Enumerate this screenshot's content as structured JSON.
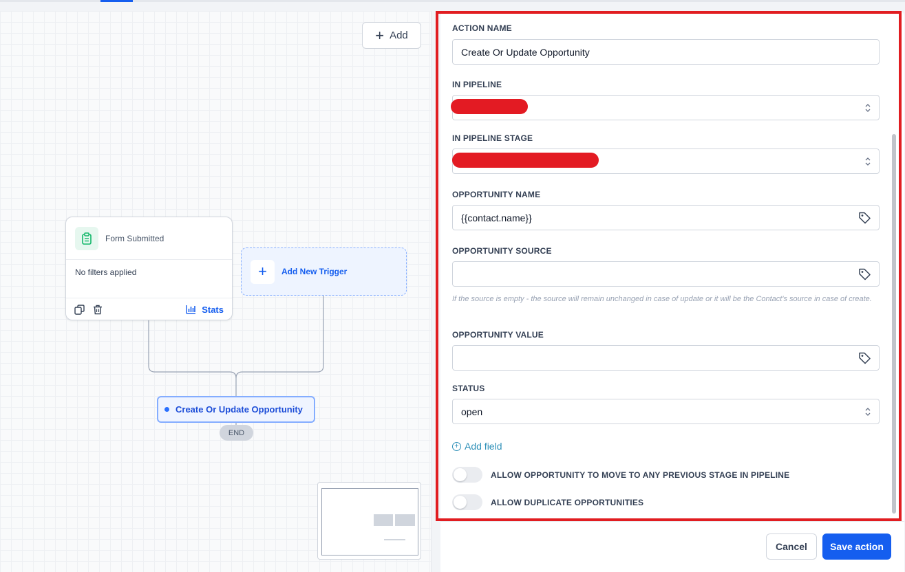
{
  "canvas": {
    "add_button_label": "Add",
    "trigger": {
      "title": "Form Submitted",
      "filters_text": "No filters applied",
      "stats_label": "Stats"
    },
    "new_trigger_label": "Add New Trigger",
    "action_node_label": "Create Or Update Opportunity",
    "end_label": "END"
  },
  "panel": {
    "action_name": {
      "label": "ACTION NAME",
      "value": "Create Or Update Opportunity"
    },
    "pipeline": {
      "label": "IN PIPELINE",
      "value": ""
    },
    "pipeline_stage": {
      "label": "IN PIPELINE STAGE",
      "value": ""
    },
    "opportunity_name": {
      "label": "OPPORTUNITY NAME",
      "value": "{{contact.name}}"
    },
    "opportunity_source": {
      "label": "OPPORTUNITY SOURCE",
      "value": "",
      "hint": "If the source is empty - the source will remain unchanged in case of update or it will be the Contact's source in case of create."
    },
    "opportunity_value": {
      "label": "OPPORTUNITY VALUE",
      "value": ""
    },
    "status": {
      "label": "STATUS",
      "value": "open"
    },
    "add_field_label": "Add field",
    "toggles": [
      {
        "label": "ALLOW OPPORTUNITY TO MOVE TO ANY PREVIOUS STAGE IN PIPELINE",
        "on": false
      },
      {
        "label": "ALLOW DUPLICATE OPPORTUNITIES",
        "on": false
      }
    ]
  },
  "footer": {
    "cancel_label": "Cancel",
    "save_label": "Save action"
  },
  "colors": {
    "accent": "#155eef",
    "highlight_outline": "#e11d21",
    "redaction": "#e31b23"
  }
}
